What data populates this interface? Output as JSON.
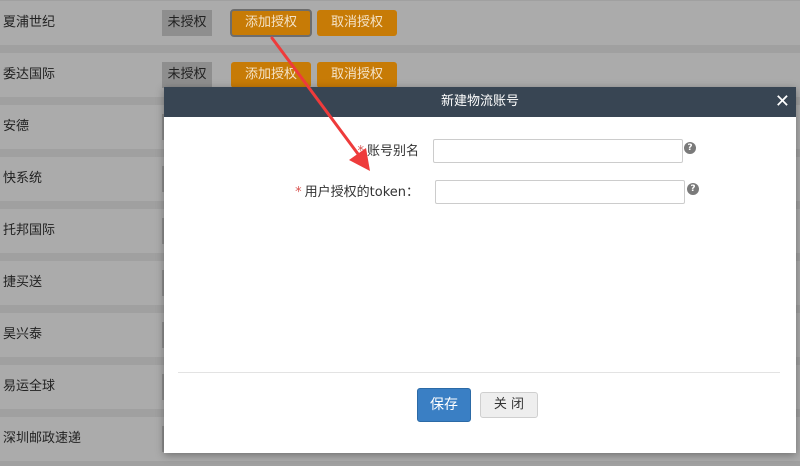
{
  "carriers": [
    {
      "name": "夏浦世纪",
      "status": "未授权",
      "add": "添加授权",
      "cancel": "取消授权"
    },
    {
      "name": "委达国际",
      "status": "未授权",
      "add": "添加授权",
      "cancel": "取消授权"
    },
    {
      "name": "安德"
    },
    {
      "name": "快系统"
    },
    {
      "name": "托邦国际"
    },
    {
      "name": "捷买送"
    },
    {
      "name": "昊兴泰"
    },
    {
      "name": "易运全球"
    },
    {
      "name": "深圳邮政速递"
    }
  ],
  "modal": {
    "title": "新建物流账号",
    "close_symbol": "✕",
    "fields": [
      {
        "required_mark": "*",
        "label": "账号别名",
        "value": "",
        "help": "?"
      },
      {
        "required_mark": "*",
        "label": "用户授权的token：",
        "value": "",
        "help": "?"
      }
    ],
    "save_label": "保存",
    "close_label": "关 闭"
  },
  "colors": {
    "header_bg": "#384553",
    "primary": "#3a7fc4",
    "orange_button": "#c77b06",
    "annotation_arrow": "#ee3b3b"
  }
}
